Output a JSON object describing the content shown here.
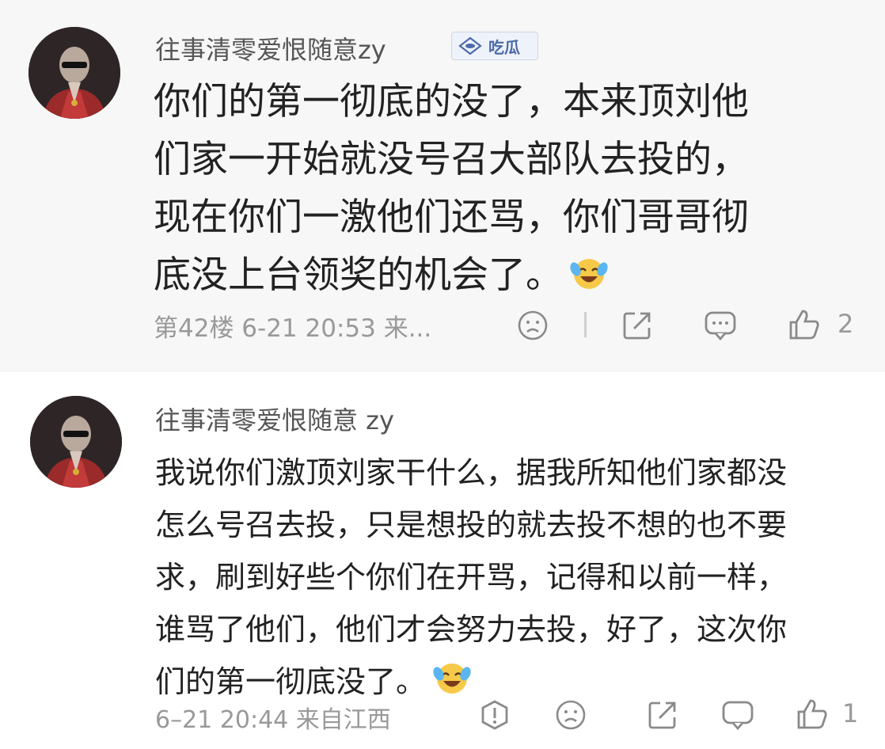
{
  "comments": [
    {
      "username": "往事清零爱恨随意zy",
      "badge": {
        "label": "吃瓜",
        "icon": "melon-badge-icon"
      },
      "lines": [
        "你们的第一彻底的没了，本来顶刘他",
        "们家一开始就没号召大部队去投的，",
        "现在你们一激他们还骂，你们哥哥彻",
        "底没上台领奖的机会了。"
      ],
      "meta": "第42楼 6-21 20:53 来...",
      "likes": "2",
      "actions": [
        "dislike-icon",
        "share-icon",
        "reply-icon",
        "like-icon"
      ]
    },
    {
      "username": "往事清零爱恨随意 zy",
      "lines": [
        "我说你们激顶刘家干什么，据我所知他们家都没",
        "怎么号召去投，只是想投的就去投不想的也不要",
        "求，刷到好些个你们在开骂，记得和以前一样，",
        "谁骂了他们，他们才会努力去投，好了，这次你",
        "们的第一彻底没了。"
      ],
      "meta": "6–21 20:44 来自江西",
      "likes": "1",
      "actions": [
        "report-icon",
        "dislike-icon",
        "share-icon",
        "reply-icon",
        "like-icon"
      ]
    }
  ],
  "colors": {
    "text": "#222222",
    "meta": "#999999",
    "username": "#555555",
    "badge": "#4d6aa8",
    "card_bg": "#f7f7f7"
  }
}
